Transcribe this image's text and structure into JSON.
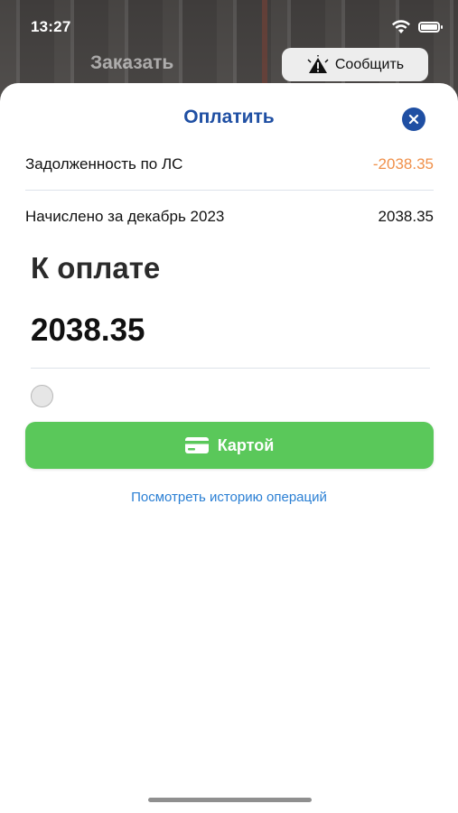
{
  "status_bar": {
    "time": "13:27",
    "wifi_icon": "wifi-icon",
    "battery_icon": "battery-icon"
  },
  "background_app": {
    "title": "Заказать",
    "report_button": {
      "label": "Сообщить",
      "icon": "warning-icon"
    }
  },
  "sheet": {
    "title": "Оплатить",
    "close_icon": "close-icon",
    "debt": {
      "label": "Задолженность по ЛС",
      "value": "-2038.35"
    },
    "accrued": {
      "label": "Начислено за декабрь 2023",
      "value": "2038.35"
    },
    "to_pay_label": "К оплате",
    "amount": "2038.35",
    "pay_button": {
      "label": "Картой",
      "icon": "credit-card-icon"
    },
    "history_link": "Посмотреть историю операций"
  },
  "colors": {
    "accent_blue": "#1f4fa3",
    "link_blue": "#2a7fd4",
    "debt_orange": "#f0904a",
    "pay_green": "#5ac85a"
  }
}
